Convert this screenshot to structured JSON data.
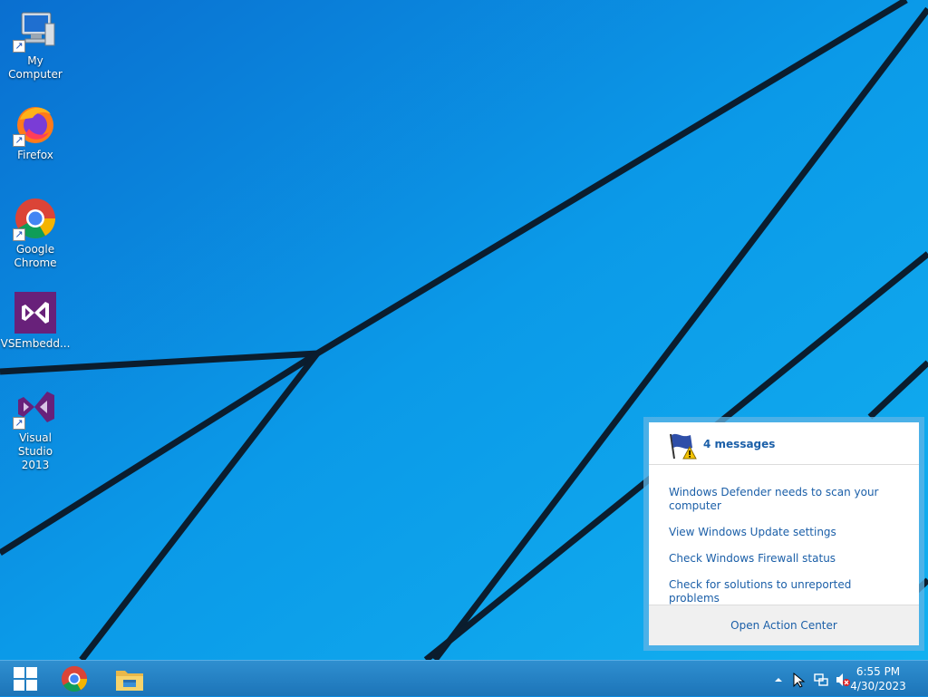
{
  "desktop": {
    "icons": [
      {
        "label": "My Computer",
        "icon": "computer-icon"
      },
      {
        "label": "Firefox",
        "icon": "firefox-icon"
      },
      {
        "label": "Google Chrome",
        "icon": "chrome-icon"
      },
      {
        "label": "VSEmbedd...",
        "icon": "vs-embedded-icon"
      },
      {
        "label": "Visual Studio 2013",
        "icon": "visual-studio-icon"
      }
    ]
  },
  "action_center": {
    "title": "4 messages",
    "messages": [
      "Windows Defender needs to scan your computer",
      "View Windows Update settings",
      "Check Windows Firewall status",
      "Check for solutions to unreported problems"
    ],
    "footer": "Open Action Center"
  },
  "taskbar": {
    "pinned": [
      "start-icon",
      "chrome-icon",
      "file-explorer-icon"
    ],
    "tray": {
      "time": "6:55 PM",
      "date": "4/30/2023"
    }
  },
  "colors": {
    "wallpaper": "#0a8ae0",
    "link": "#1b5fa8",
    "taskbar": "#1c74b8"
  }
}
